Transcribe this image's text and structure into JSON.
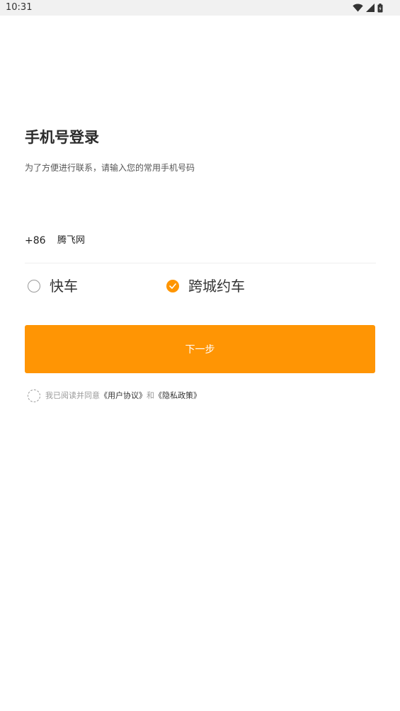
{
  "status_bar": {
    "time": "10:31",
    "icons": [
      "wifi-icon",
      "cellular-signal-icon",
      "battery-icon"
    ]
  },
  "login": {
    "title": "手机号登录",
    "subtitle": "为了方便进行联系，请输入您的常用手机号码"
  },
  "phone": {
    "country_code": "+86",
    "value": "腾飞网"
  },
  "ride_types": {
    "quick": {
      "label": "快车",
      "selected": false
    },
    "intercity": {
      "label": "跨城约车",
      "selected": true
    }
  },
  "next_button": {
    "label": "下一步"
  },
  "agreement": {
    "prefix": "我已阅读并同意",
    "user_agreement": "《用户协议》",
    "conjunction": "和",
    "privacy_policy": "《隐私政策》",
    "checked": false
  },
  "colors": {
    "accent": "#ff9504",
    "status_bar_bg": "#f1f1f1",
    "text_primary": "#222222",
    "text_secondary": "#999999"
  }
}
